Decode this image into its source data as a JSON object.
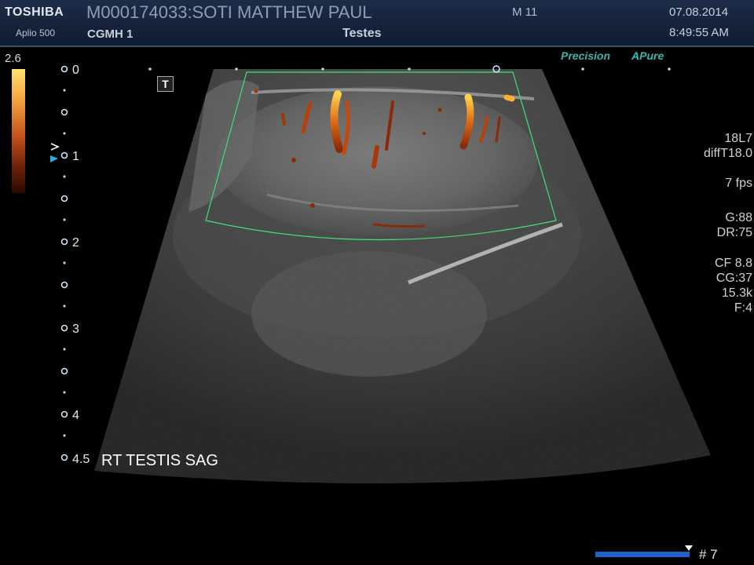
{
  "header": {
    "brand": "TOSHIBA",
    "model": "Aplio 500",
    "patient": "M000174033:SOTI MATTHEW PAUL",
    "hospital": "CGMH 1",
    "mode": "M 11",
    "exam": "Testes",
    "date": "07.08.2014",
    "time": "8:49:55 AM"
  },
  "logos": {
    "precision": "Precision",
    "apure_a": "A",
    "apure": "Pure"
  },
  "color_scale": {
    "max": "2.6"
  },
  "depth_scale": {
    "labels": [
      "0",
      "1",
      "2",
      "3",
      "4",
      "4.5"
    ]
  },
  "params": {
    "probe": "18L7",
    "freq": "diffT18.0",
    "fps": "7 fps",
    "gain": "G:88",
    "dr": "DR:75",
    "cf": "CF 8.8",
    "cg": "CG:37",
    "prf": "15.3k",
    "filter": "F:4"
  },
  "annotation": "RT TESTIS SAG",
  "t_badge": "T",
  "cine": {
    "frame": "# 7"
  },
  "colors": {
    "roi": "#3ee07a",
    "doppler": "#d4601c",
    "header": "#16243c"
  }
}
